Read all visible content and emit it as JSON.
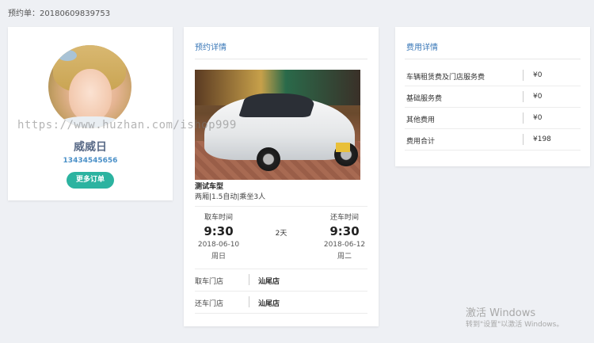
{
  "order": {
    "label": "预约单：20180609839753"
  },
  "profile": {
    "name": "威威日",
    "phone": "13434545656",
    "more_orders_button": "更多订单"
  },
  "booking": {
    "title": "预约详情",
    "car_model": "测试车型",
    "car_spec": "两厢|1.5自动|乘坐3人",
    "pickup": {
      "label": "取车时间",
      "time": "9:30",
      "date": "2018-06-10",
      "weekday": "周日"
    },
    "return": {
      "label": "还车时间",
      "time": "9:30",
      "date": "2018-06-12",
      "weekday": "周二"
    },
    "duration": "2天",
    "stores": [
      {
        "label": "取车门店",
        "value": "汕尾店"
      },
      {
        "label": "还车门店",
        "value": "汕尾店"
      }
    ]
  },
  "fees": {
    "title": "费用详情",
    "rows": [
      {
        "label": "车辆租赁费及门店服务费",
        "value": "¥0"
      },
      {
        "label": "基础服务费",
        "value": "¥0"
      },
      {
        "label": "其他费用",
        "value": "¥0"
      },
      {
        "label": "费用合计",
        "value": "¥198"
      }
    ]
  },
  "watermarks": {
    "url": "https://www.huzhan.com/ishop999",
    "activate_title": "激活 Windows",
    "activate_sub": "转到\"设置\"以激活 Windows。"
  },
  "colors": {
    "accent_blue": "#3a78b8",
    "button_teal": "#2cb3a0",
    "background": "#eef0f4"
  }
}
